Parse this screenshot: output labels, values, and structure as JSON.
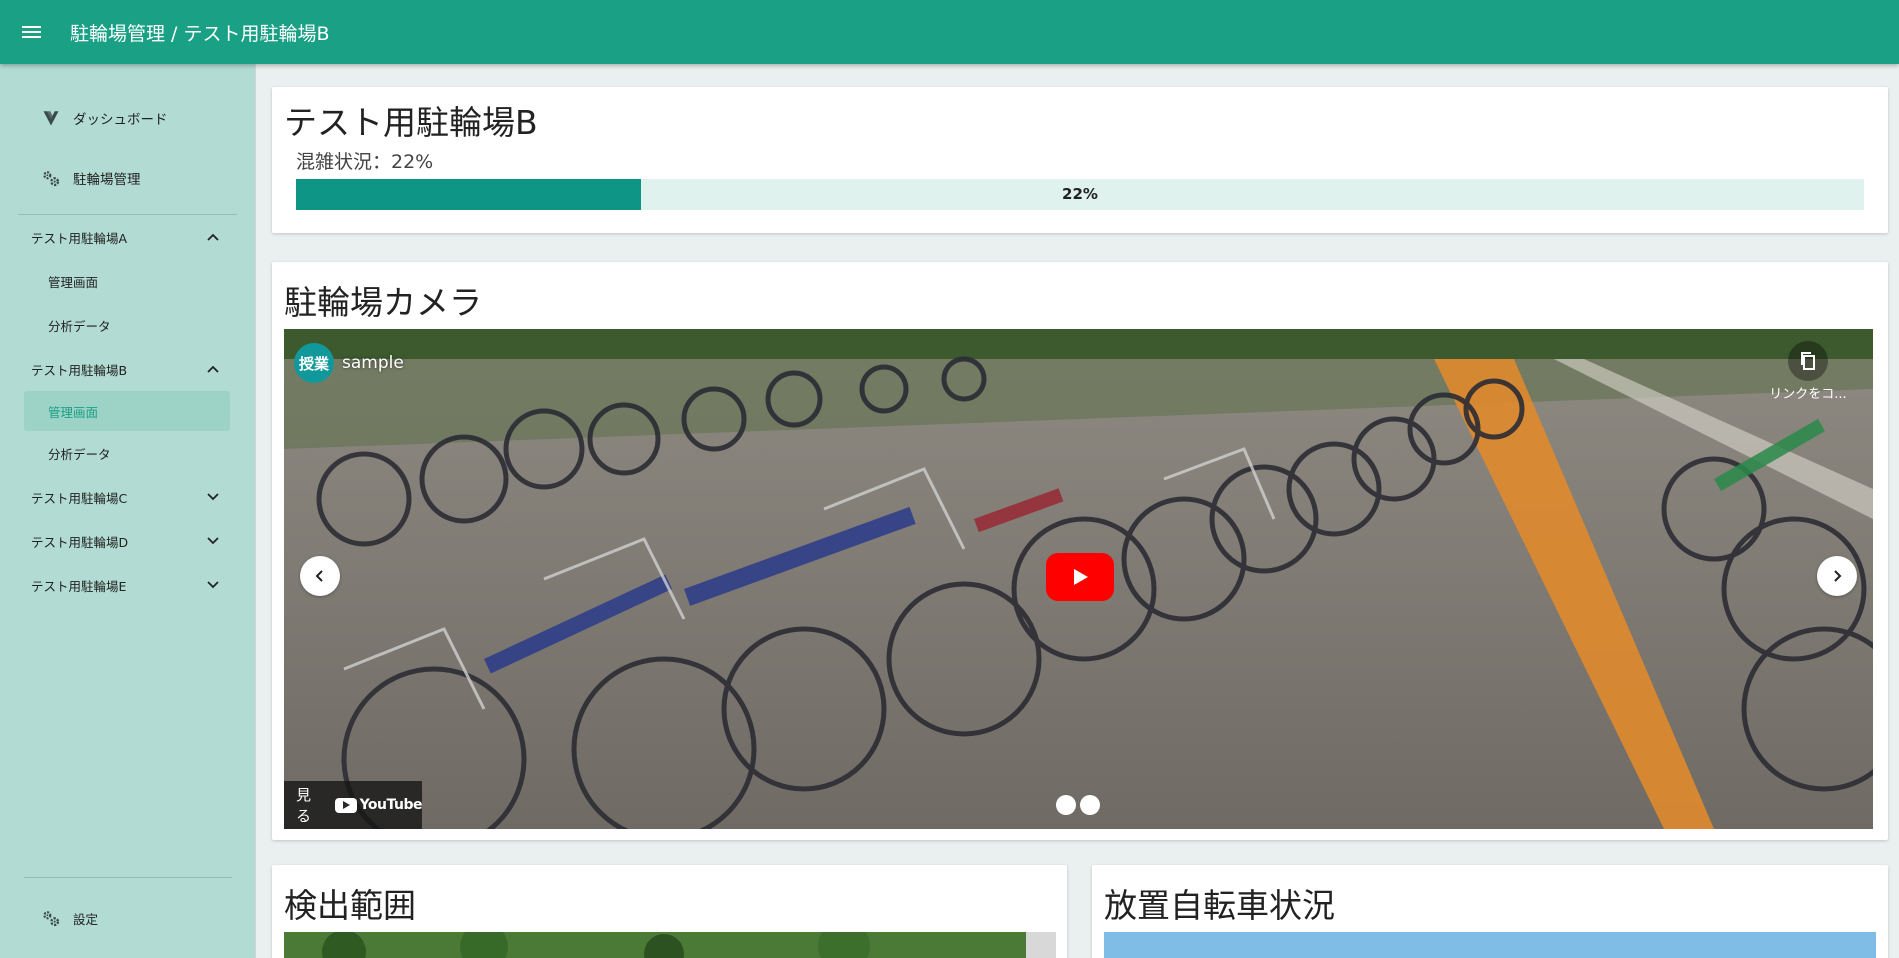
{
  "app": {
    "title": "駐輪場管理 / テスト用駐輪場B"
  },
  "sidebar": {
    "top_items": [
      {
        "label": "ダッシュボード",
        "icon": "vuetify-logo-icon"
      },
      {
        "label": "駐輪場管理",
        "icon": "gears-icon"
      }
    ],
    "groups": [
      {
        "label": "テスト用駐輪場A",
        "expanded": true,
        "items": [
          "管理画面",
          "分析データ"
        ]
      },
      {
        "label": "テスト用駐輪場B",
        "expanded": true,
        "items": [
          "管理画面",
          "分析データ"
        ],
        "active_item": "管理画面"
      },
      {
        "label": "テスト用駐輪場C",
        "expanded": false
      },
      {
        "label": "テスト用駐輪場D",
        "expanded": false
      },
      {
        "label": "テスト用駐輪場E",
        "expanded": false
      }
    ],
    "bottom_item": {
      "label": "設定",
      "icon": "gears-icon"
    }
  },
  "status_card": {
    "title": "テスト用駐輪場B",
    "congestion_label": "混雑状況：22%",
    "progress_value": 22,
    "progress_text": "22%"
  },
  "camera_card": {
    "title": "駐輪場カメラ",
    "video": {
      "channel_avatar_text": "授業",
      "channel_name": "sample",
      "copy_link_label": "リンクをコ...",
      "watch_label": "見る",
      "youtube_logo": "YouTube"
    }
  },
  "detection_card": {
    "title": "検出範囲"
  },
  "abandoned_card": {
    "title": "放置自転車状況"
  },
  "colors": {
    "appbar": "#1aa085",
    "sidebar": "#b2dcd3",
    "progress_fill": "#0f9585",
    "progress_track": "#dff2ee",
    "active_item_bg": "#9dd3c6"
  }
}
